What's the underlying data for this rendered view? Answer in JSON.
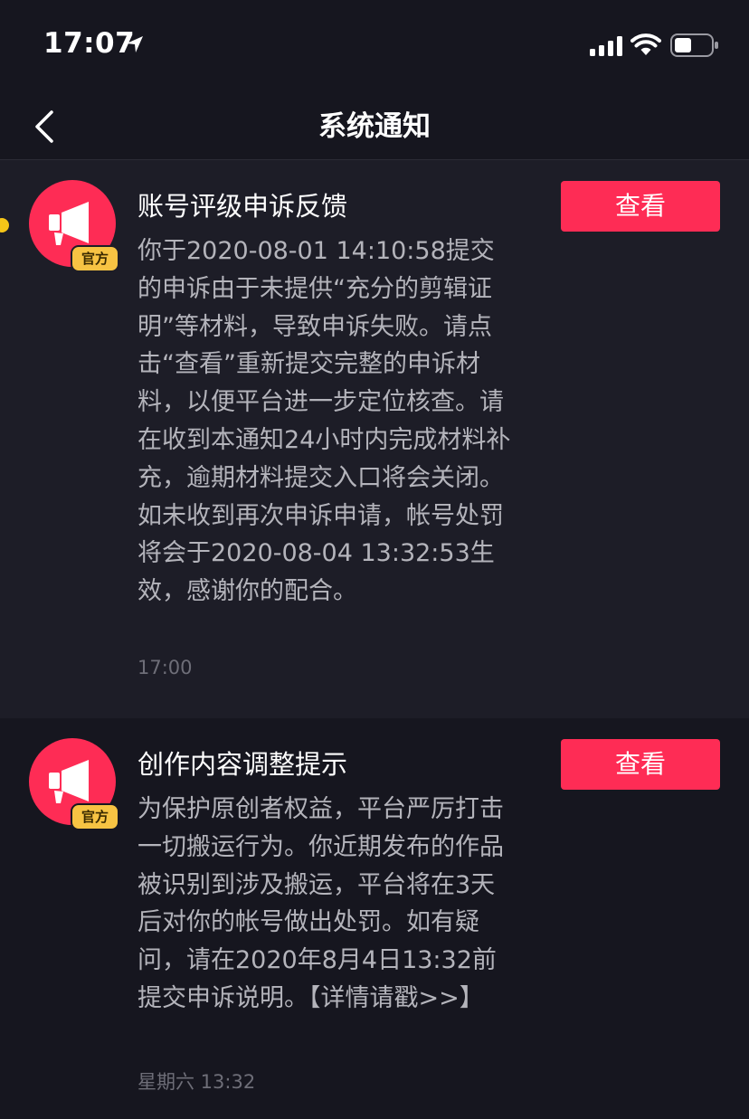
{
  "status_bar": {
    "time": "17:07",
    "icons": [
      "location-arrow-icon",
      "signal-icon",
      "wifi-icon",
      "battery-icon"
    ]
  },
  "nav": {
    "title": "系统通知",
    "back_icon": "chevron-left-icon"
  },
  "colors": {
    "background": "#16161f",
    "card_highlight": "#1d1d27",
    "accent": "#fe2c55",
    "badge": "#f7c343",
    "unread_dot": "#f5c518"
  },
  "notifications": [
    {
      "title": "账号评级申诉反馈",
      "badge": "官方",
      "body": "你于2020-08-01 14:10:58提交的申诉由于未提供“充分的剪辑证明”等材料，导致申诉失败。请点击“查看”重新提交完整的申诉材料，以便平台进一步定位核查。请在收到本通知24小时内完成材料补充，逾期材料提交入口将会关闭。如未收到再次申诉申请，帐号处罚将会于2020-08-04 13:32:53生效，感谢你的配合。",
      "time": "17:00",
      "button": "查看",
      "unread": true
    },
    {
      "title": "创作内容调整提示",
      "badge": "官方",
      "body": "为保护原创者权益，平台严厉打击一切搬运行为。你近期发布的作品被识别到涉及搬运，平台将在3天后对你的帐号做出处罚。如有疑问，请在2020年8月4日13:32前提交申诉说明。【详情请戳>>】",
      "time": "星期六 13:32",
      "button": "查看",
      "unread": false
    }
  ]
}
